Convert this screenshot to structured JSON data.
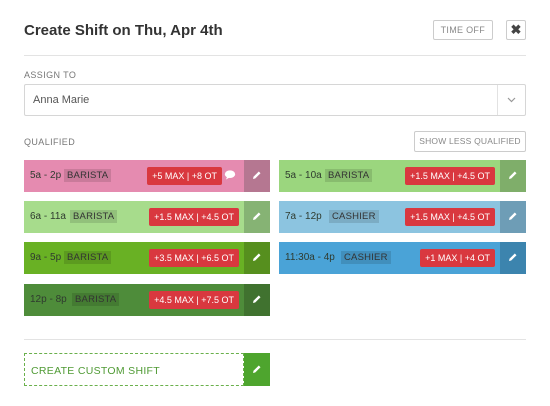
{
  "header": {
    "title": "Create Shift on Thu, Apr 4th",
    "time_off_label": "TIME OFF",
    "close_glyph": "✖"
  },
  "assign": {
    "label": "ASSIGN TO",
    "value": "Anna Marie"
  },
  "qualified": {
    "label": "QUALIFIED",
    "show_less_label": "SHOW LESS QUALIFIED"
  },
  "shifts": [
    {
      "time": "5a - 2p",
      "role": "BARISTA",
      "badge": "+5 MAX | +8 OT",
      "has_comment": true,
      "color": "#e58bb0",
      "edit_color": "#b57791"
    },
    {
      "time": "5a - 10a",
      "role": "BARISTA",
      "badge": "+1.5 MAX | +4.5 OT",
      "has_comment": false,
      "color": "#9bd67e",
      "edit_color": "#7fae6a"
    },
    {
      "time": "6a - 11a",
      "role": "BARISTA",
      "badge": "+1.5 MAX | +4.5 OT",
      "has_comment": false,
      "color": "#a7dc8c",
      "edit_color": "#86b374"
    },
    {
      "time": "7a - 12p",
      "role": "CASHIER",
      "badge": "+1.5 MAX | +4.5 OT",
      "has_comment": false,
      "color": "#8cc4e0",
      "edit_color": "#6e9db6"
    },
    {
      "time": "9a - 5p",
      "role": "BARISTA",
      "badge": "+3.5 MAX | +6.5 OT",
      "has_comment": false,
      "color": "#69b124",
      "edit_color": "#568f1e"
    },
    {
      "time": "11:30a - 4p",
      "role": "CASHIER",
      "badge": "+1 MAX | +4 OT",
      "has_comment": false,
      "color": "#4aa3d7",
      "edit_color": "#3c84ae"
    },
    {
      "time": "12p - 8p",
      "role": "BARISTA",
      "badge": "+4.5 MAX | +7.5 OT",
      "has_comment": false,
      "color": "#4e8c3a",
      "edit_color": "#40722f"
    }
  ],
  "custom": {
    "label": "CREATE CUSTOM SHIFT"
  }
}
